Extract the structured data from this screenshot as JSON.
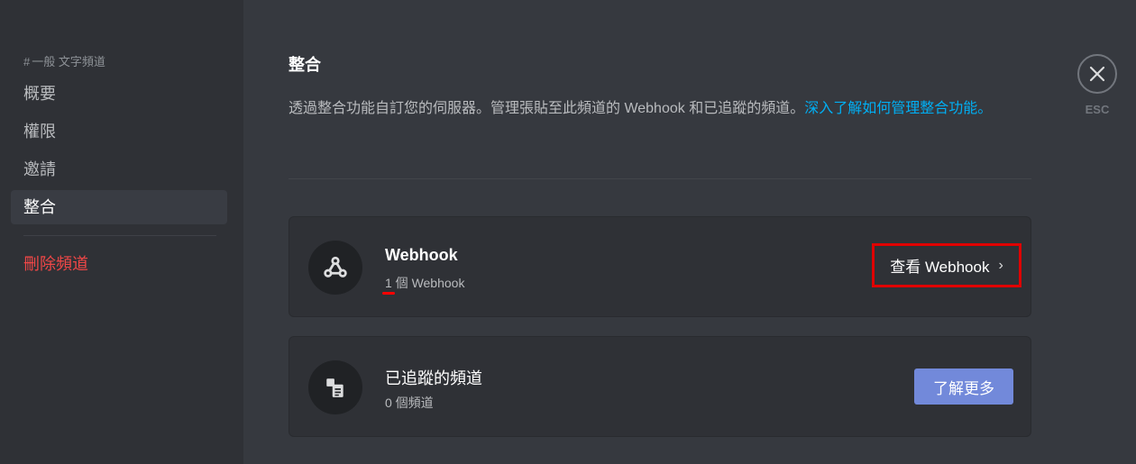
{
  "sidebar": {
    "channel_hash": "#",
    "channel_header": "一般 文字頻道",
    "items": [
      {
        "label": "概要"
      },
      {
        "label": "權限"
      },
      {
        "label": "邀請"
      },
      {
        "label": "整合"
      }
    ],
    "danger_item": "刪除頻道"
  },
  "main": {
    "title": "整合",
    "description": "透過整合功能自訂您的伺服器。管理張貼至此頻道的 Webhook 和已追蹤的頻道。",
    "link_text": "深入了解如何管理整合功能。",
    "webhook_card": {
      "icon": "webhook-icon",
      "title": "Webhook",
      "subtitle": "1 個 Webhook",
      "button_label": "查看 Webhook",
      "button_chevron": "›"
    },
    "followed_card": {
      "icon": "followed-channel-icon",
      "title": "已追蹤的頻道",
      "subtitle": "0 個頻道",
      "button_label": "了解更多"
    }
  },
  "close": {
    "icon": "close-icon",
    "label": "ESC"
  },
  "colors": {
    "accent": "#7289da",
    "link": "#00aff4",
    "danger": "#f04747",
    "highlight": "#e00000"
  }
}
